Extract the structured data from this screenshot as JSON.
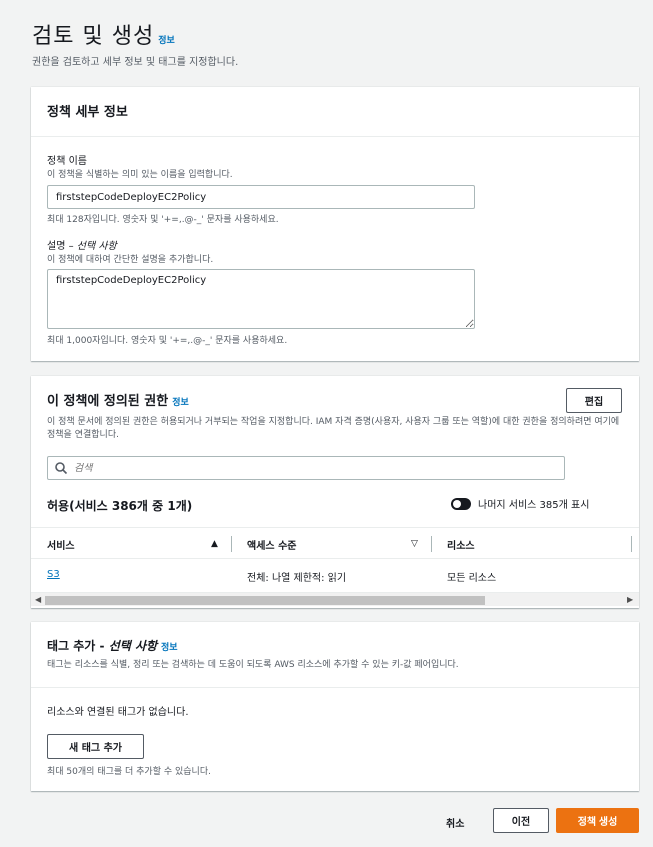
{
  "header": {
    "title": "검토 및 생성",
    "info": "정보",
    "description": "권한을 검토하고 세부 정보 및 태그를 지정합니다."
  },
  "details": {
    "title": "정책 세부 정보",
    "name_label": "정책 이름",
    "name_hint": "이 정책을 식별하는 의미 있는 이름을 입력합니다.",
    "name_value": "firststepCodeDeployEC2Policy",
    "name_constraint": "최대 128자입니다. 영숫자 및 '+=,.@-_' 문자를 사용하세요.",
    "desc_label": "설명 –",
    "desc_optional": "선택 사항",
    "desc_hint": "이 정책에 대하여 간단한 설명을 추가합니다.",
    "desc_value": "firststepCodeDeployEC2Policy",
    "desc_constraint": "최대 1,000자입니다. 영숫자 및 '+=,.@-_' 문자를 사용하세요."
  },
  "permissions": {
    "title": "이 정책에 정의된 권한",
    "info": "정보",
    "edit_label": "편집",
    "description": "이 정책 문서에 정의된 권한은 허용되거나 거부되는 작업을 지정합니다. IAM 자격 증명(사용자, 사용자 그룹 또는 역할)에 대한 권한을 정의하려면 여기에 정책을 연결합니다.",
    "search_placeholder": "검색",
    "allow_heading": "허용(서비스 386개 중 1개)",
    "toggle_label": "나머지 서비스 385개 표시",
    "columns": {
      "service": "서비스",
      "access": "액세스 수준",
      "resource": "리소스"
    },
    "rows": [
      {
        "service": "S3",
        "access": "전체: 나열 제한적: 읽기",
        "resource": "모든 리소스"
      }
    ]
  },
  "tags": {
    "title": "태그 추가 -",
    "optional": "선택 사항",
    "info": "정보",
    "description": "태그는 리소스를 식별, 정리 또는 검색하는 데 도움이 되도록 AWS 리소스에 추가할 수 있는 키-값 페어입니다.",
    "empty": "리소스와 연결된 태그가 없습니다.",
    "add_label": "새 태그 추가",
    "limit": "최대 50개의 태그를 더 추가할 수 있습니다."
  },
  "footer": {
    "cancel": "취소",
    "previous": "이전",
    "create": "정책 생성"
  },
  "colors": {
    "link": "#0073bb",
    "primary": "#ec7211",
    "text": "#16191f",
    "secondary_text": "#545b64",
    "background": "#f2f3f3"
  }
}
